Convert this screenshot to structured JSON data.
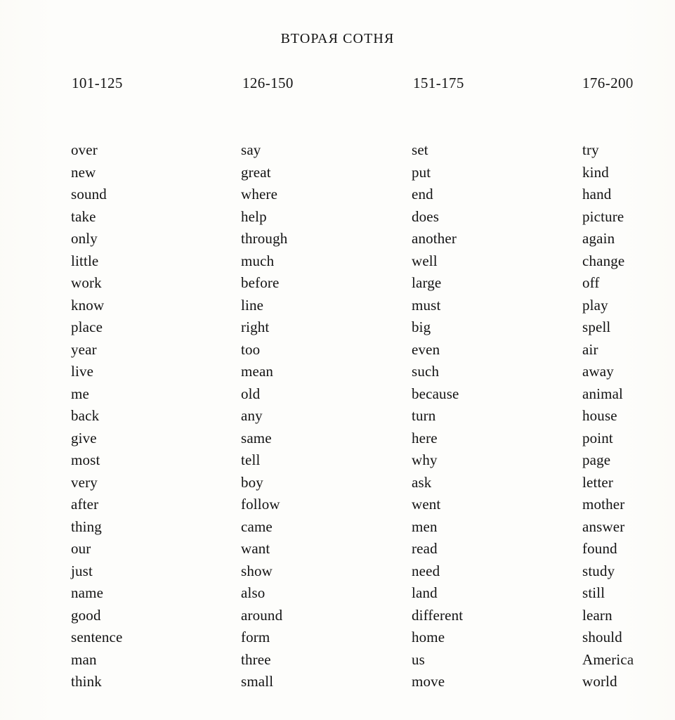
{
  "document": {
    "title": "ВТОРАЯ СОТНЯ",
    "background_color": "#fdfdfb",
    "text_color": "#131313"
  },
  "columns": [
    {
      "header": "101-125",
      "words": [
        "over",
        "new",
        "sound",
        "take",
        "only",
        "little",
        "work",
        "know",
        "place",
        "year",
        "live",
        "me",
        "back",
        "give",
        "most",
        "very",
        "after",
        "thing",
        "our",
        "just",
        "name",
        "good",
        "sentence",
        "man",
        "think"
      ]
    },
    {
      "header": "126-150",
      "words": [
        "say",
        "great",
        "where",
        "help",
        "through",
        "much",
        "before",
        "line",
        "right",
        "too",
        "mean",
        "old",
        "any",
        "same",
        "tell",
        "boy",
        "follow",
        "came",
        "want",
        "show",
        "also",
        "around",
        "form",
        "three",
        "small"
      ]
    },
    {
      "header": "151-175",
      "words": [
        "set",
        "put",
        "end",
        "does",
        "another",
        "well",
        "large",
        "must",
        "big",
        "even",
        "such",
        "because",
        "turn",
        "here",
        "why",
        "ask",
        "went",
        "men",
        "read",
        "need",
        "land",
        "different",
        "home",
        "us",
        "move"
      ]
    },
    {
      "header": "176-200",
      "words": [
        "try",
        "kind",
        "hand",
        "picture",
        "again",
        "change",
        "off",
        "play",
        "spell",
        "air",
        "away",
        "animal",
        "house",
        "point",
        "page",
        "letter",
        "mother",
        "answer",
        "found",
        "study",
        "still",
        "learn",
        "should",
        "America",
        "world"
      ]
    }
  ]
}
